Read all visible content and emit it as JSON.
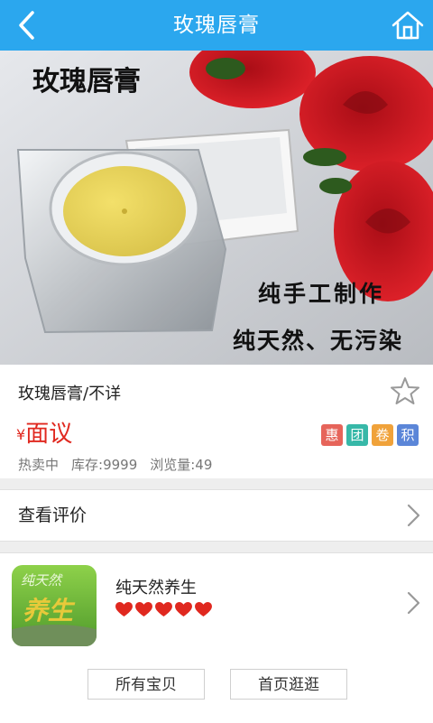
{
  "header": {
    "title": "玫瑰唇膏",
    "back_icon": "chevron-left-icon",
    "home_icon": "home-icon"
  },
  "hero": {
    "caption_title": "玫瑰唇膏",
    "caption_line1": "纯手工制作",
    "caption_line2": "纯天然、无污染"
  },
  "product": {
    "name": "玫瑰唇膏/不详",
    "currency": "¥",
    "price": "面议",
    "badges": [
      {
        "label": "惠",
        "color": "#e6645a"
      },
      {
        "label": "团",
        "color": "#37b8a8"
      },
      {
        "label": "卷",
        "color": "#f0a23a"
      },
      {
        "label": "积",
        "color": "#5b86d8"
      }
    ],
    "stats": {
      "hot": "热卖中",
      "stock": "库存:9999",
      "views": "浏览量:49"
    }
  },
  "reviews": {
    "label": "查看评价"
  },
  "shop": {
    "logo_text_top": "纯天然",
    "logo_text_main": "养生",
    "name": "纯天然养生",
    "rating": 5,
    "all_items": "所有宝贝",
    "home": "首页逛逛"
  },
  "colors": {
    "header": "#2ba7ee",
    "price": "#e0281f",
    "heart": "#e0281f"
  }
}
